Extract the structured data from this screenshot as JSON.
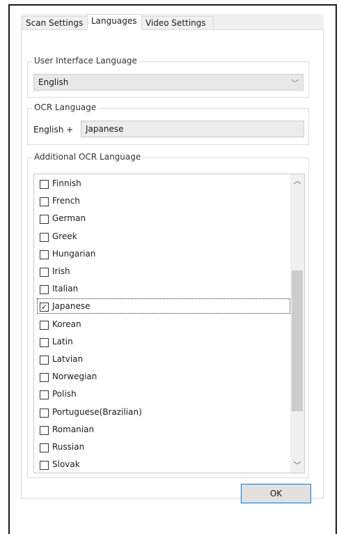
{
  "tabs": [
    {
      "label": "Scan Settings",
      "active": false
    },
    {
      "label": "Languages",
      "active": true
    },
    {
      "label": "Video Settings",
      "active": false
    }
  ],
  "ui_language": {
    "title": "User Interface Language",
    "selected": "English",
    "arrow_icon": "chevron-down-icon"
  },
  "ocr_language": {
    "title": "OCR Language",
    "prefix": "English +",
    "value": "Japanese"
  },
  "additional_ocr": {
    "title": "Additional OCR Language",
    "items": [
      {
        "label": "Finnish",
        "checked": false
      },
      {
        "label": "French",
        "checked": false
      },
      {
        "label": "German",
        "checked": false
      },
      {
        "label": "Greek",
        "checked": false
      },
      {
        "label": "Hungarian",
        "checked": false
      },
      {
        "label": "Irish",
        "checked": false
      },
      {
        "label": "Italian",
        "checked": false
      },
      {
        "label": "Japanese",
        "checked": true,
        "focused": true
      },
      {
        "label": "Korean",
        "checked": false
      },
      {
        "label": "Latin",
        "checked": false
      },
      {
        "label": "Latvian",
        "checked": false
      },
      {
        "label": "Norwegian",
        "checked": false
      },
      {
        "label": "Polish",
        "checked": false
      },
      {
        "label": "Portuguese(Brazilian)",
        "checked": false
      },
      {
        "label": "Romanian",
        "checked": false
      },
      {
        "label": "Russian",
        "checked": false
      },
      {
        "label": "Slovak",
        "checked": false
      }
    ],
    "scroll_up_icon": "chevron-up-icon",
    "scroll_down_icon": "chevron-down-icon"
  },
  "ok_label": "OK"
}
